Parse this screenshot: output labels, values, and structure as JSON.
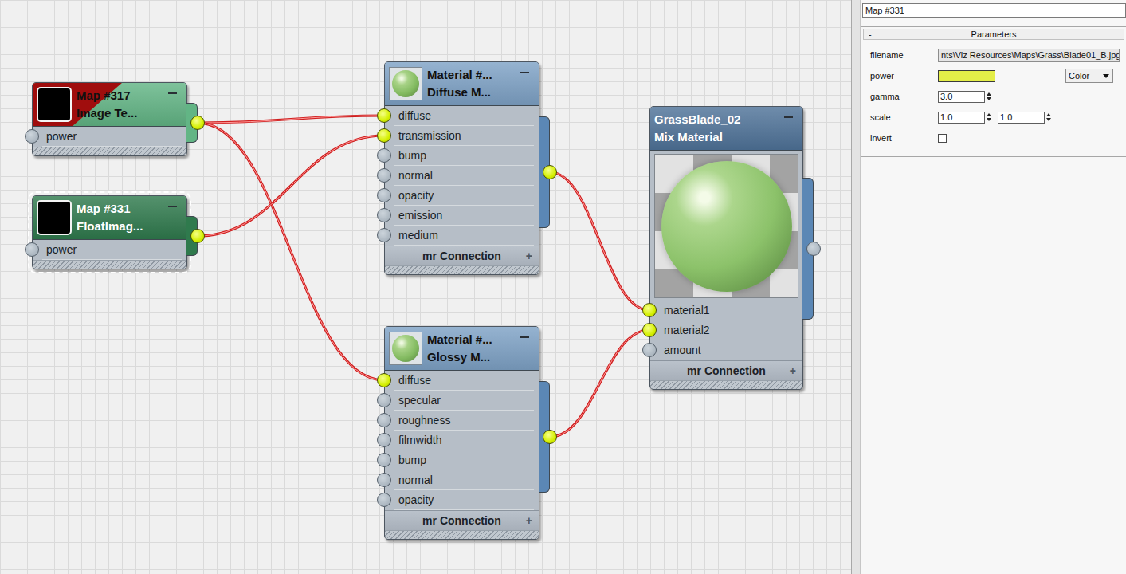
{
  "editor": {
    "name_field": "Map #331"
  },
  "nodes": [
    {
      "kind": "map",
      "title": [
        "Map #317",
        "Image Te..."
      ],
      "color": "#62b585",
      "error": true,
      "selected": false,
      "output_connected": true,
      "inputs": [
        {
          "label": "power",
          "connected": false
        }
      ]
    },
    {
      "kind": "map",
      "title": [
        "Map #331",
        "FloatImag..."
      ],
      "color": "#2f7a4d",
      "error": false,
      "selected": true,
      "output_connected": true,
      "inputs": [
        {
          "label": "power",
          "connected": false
        }
      ]
    },
    {
      "kind": "material",
      "title": [
        "Material #...",
        "Diffuse M..."
      ],
      "color": "#7ea2c6",
      "error": false,
      "selected": false,
      "output_connected": true,
      "inputs": [
        {
          "label": "diffuse",
          "connected": true
        },
        {
          "label": "transmission",
          "connected": true
        },
        {
          "label": "bump",
          "connected": false
        },
        {
          "label": "normal",
          "connected": false
        },
        {
          "label": "opacity",
          "connected": false
        },
        {
          "label": "emission",
          "connected": false
        },
        {
          "label": "medium",
          "connected": false
        }
      ],
      "footer": "mr Connection",
      "footer_icon": "+"
    },
    {
      "kind": "material",
      "title": [
        "Material #...",
        "Glossy M..."
      ],
      "color": "#7ea2c6",
      "error": false,
      "selected": false,
      "output_connected": true,
      "inputs": [
        {
          "label": "diffuse",
          "connected": true
        },
        {
          "label": "specular",
          "connected": false
        },
        {
          "label": "roughness",
          "connected": false
        },
        {
          "label": "filmwidth",
          "connected": false
        },
        {
          "label": "bump",
          "connected": false
        },
        {
          "label": "normal",
          "connected": false
        },
        {
          "label": "opacity",
          "connected": false
        }
      ],
      "footer": "mr Connection",
      "footer_icon": "+"
    },
    {
      "kind": "mix",
      "title": [
        "GrassBlade_02",
        "Mix Material"
      ],
      "color": "#4f7399",
      "error": false,
      "selected": false,
      "output_connected": false,
      "inputs": [
        {
          "label": "material1",
          "connected": true
        },
        {
          "label": "material2",
          "connected": true
        },
        {
          "label": "amount",
          "connected": false
        }
      ],
      "footer": "mr Connection",
      "footer_icon": "+"
    }
  ],
  "links": [
    {
      "from_node": 0,
      "to_node": 2,
      "to_input": 0
    },
    {
      "from_node": 0,
      "to_node": 3,
      "to_input": 0
    },
    {
      "from_node": 1,
      "to_node": 2,
      "to_input": 1
    },
    {
      "from_node": 2,
      "to_node": 4,
      "to_input": 0
    },
    {
      "from_node": 3,
      "to_node": 4,
      "to_input": 1
    }
  ],
  "parameters": {
    "collapse": "-",
    "title": "Parameters",
    "rows": [
      {
        "kind": "file",
        "label": "filename",
        "value": "nts\\Viz Resources\\Maps\\Grass\\Blade01_B.jpg"
      },
      {
        "kind": "color",
        "label": "power",
        "color": "#e4ee48",
        "dropdown": "Color"
      },
      {
        "kind": "spinner",
        "label": "gamma",
        "values": [
          "3.0"
        ]
      },
      {
        "kind": "spinner",
        "label": "scale",
        "values": [
          "1.0",
          "1.0"
        ]
      },
      {
        "kind": "checkbox",
        "label": "invert",
        "checked": false
      }
    ]
  }
}
